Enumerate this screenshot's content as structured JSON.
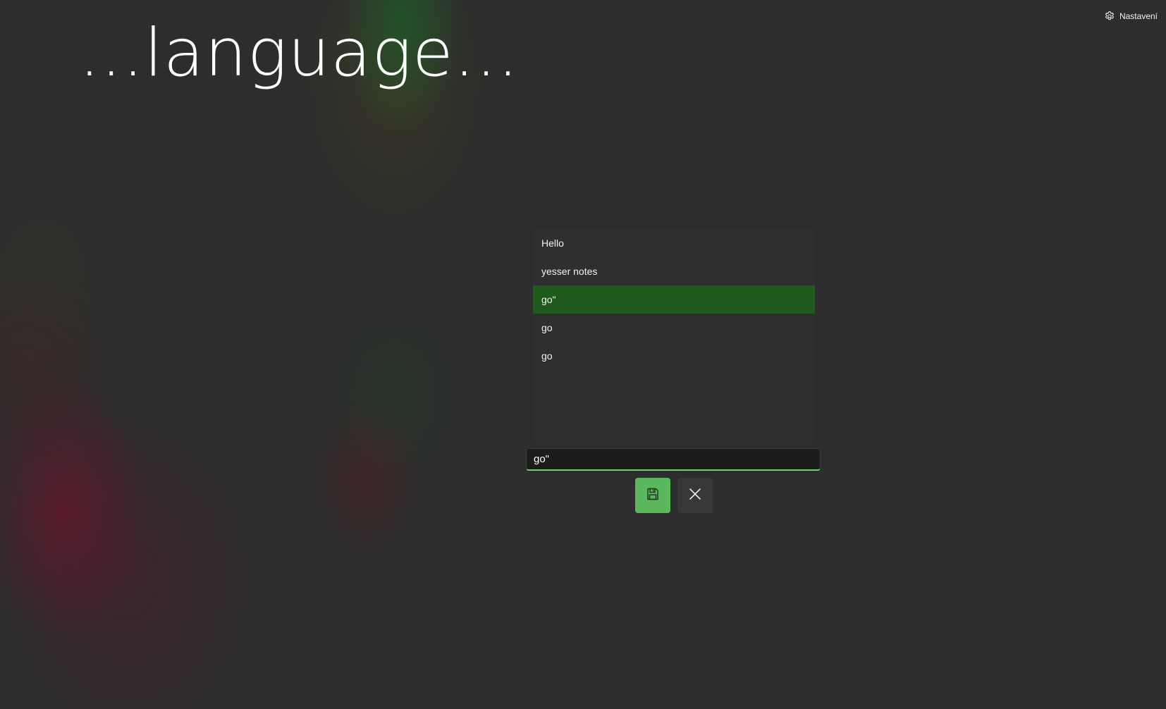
{
  "settings": {
    "label": "Nastavení",
    "icon": "gear-icon"
  },
  "header": {
    "title": "...language..."
  },
  "notes": {
    "items": [
      {
        "label": "Hello",
        "selected": false
      },
      {
        "label": "yesser notes",
        "selected": false
      },
      {
        "label": "go\"",
        "selected": true
      },
      {
        "label": "go",
        "selected": false
      },
      {
        "label": "go",
        "selected": false
      }
    ]
  },
  "editor": {
    "value": "go\""
  },
  "actions": {
    "save_icon": "floppy-disk-icon",
    "cancel_icon": "close-icon"
  },
  "colors": {
    "background": "#2d2d2d",
    "selected_item": "#1f5a1c",
    "accent": "#5cb85c",
    "input_underline": "#6fcf67"
  }
}
